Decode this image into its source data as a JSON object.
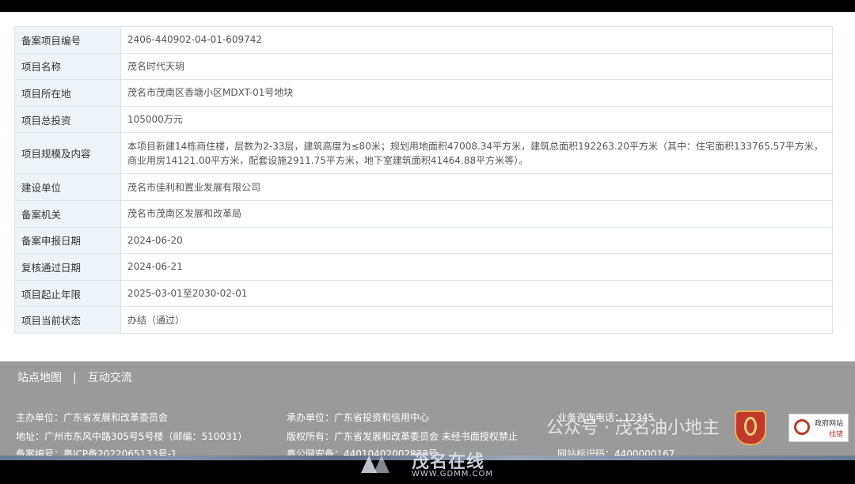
{
  "table": {
    "rows": [
      {
        "label": "备案项目编号",
        "value": "2406-440902-04-01-609742"
      },
      {
        "label": "项目名称",
        "value": "茂名时代天玥"
      },
      {
        "label": "项目所在地",
        "value": "茂名市茂南区香塘小区MDXT-01号地块"
      },
      {
        "label": "项目总投资",
        "value": "105000万元"
      },
      {
        "label": "项目规模及内容",
        "value": "本项目新建14栋商住楼，层数为2-33层，建筑高度为≤80米；规划用地面积47008.34平方米，建筑总面积192263.20平方米（其中：住宅面积133765.57平方米，商业用房14121.00平方米，配套设施2911.75平方米，地下室建筑面积41464.88平方米等）。"
      },
      {
        "label": "建设单位",
        "value": "茂名市佳利和置业发展有限公司"
      },
      {
        "label": "备案机关",
        "value": "茂名市茂南区发展和改革局"
      },
      {
        "label": "备案申报日期",
        "value": "2024-06-20"
      },
      {
        "label": "复核通过日期",
        "value": "2024-06-21"
      },
      {
        "label": "项目起止年限",
        "value": "2025-03-01至2030-02-01"
      },
      {
        "label": "项目当前状态",
        "value": "办结（通过）"
      }
    ]
  },
  "footer": {
    "nav": {
      "sitemap": "站点地图",
      "separator": "|",
      "interact": "互动交流"
    },
    "sponsor": "主办单位：广东省发展和改革委员会",
    "organizer": "承办单位：广东省投资和信用中心",
    "hotline": "业务咨询电话：12345",
    "address": "地址：广州市东风中路305号5号楼（邮编：510031）",
    "copyright": "版权所有：广东省发展和改革委员会 未经书面授权禁止",
    "icp": "备案编号：粤ICP备2022065133号-1",
    "police": "粤公网安备：44010402002833号",
    "site_id": "网站标识码：4400000167",
    "gov_badge_top": "政府网站",
    "gov_badge_bottom": "找错"
  },
  "watermark": {
    "overlay": "公众号 · 茂名油小地主",
    "logo": "茂名在线",
    "url": "WWW.GDMM.COM"
  }
}
